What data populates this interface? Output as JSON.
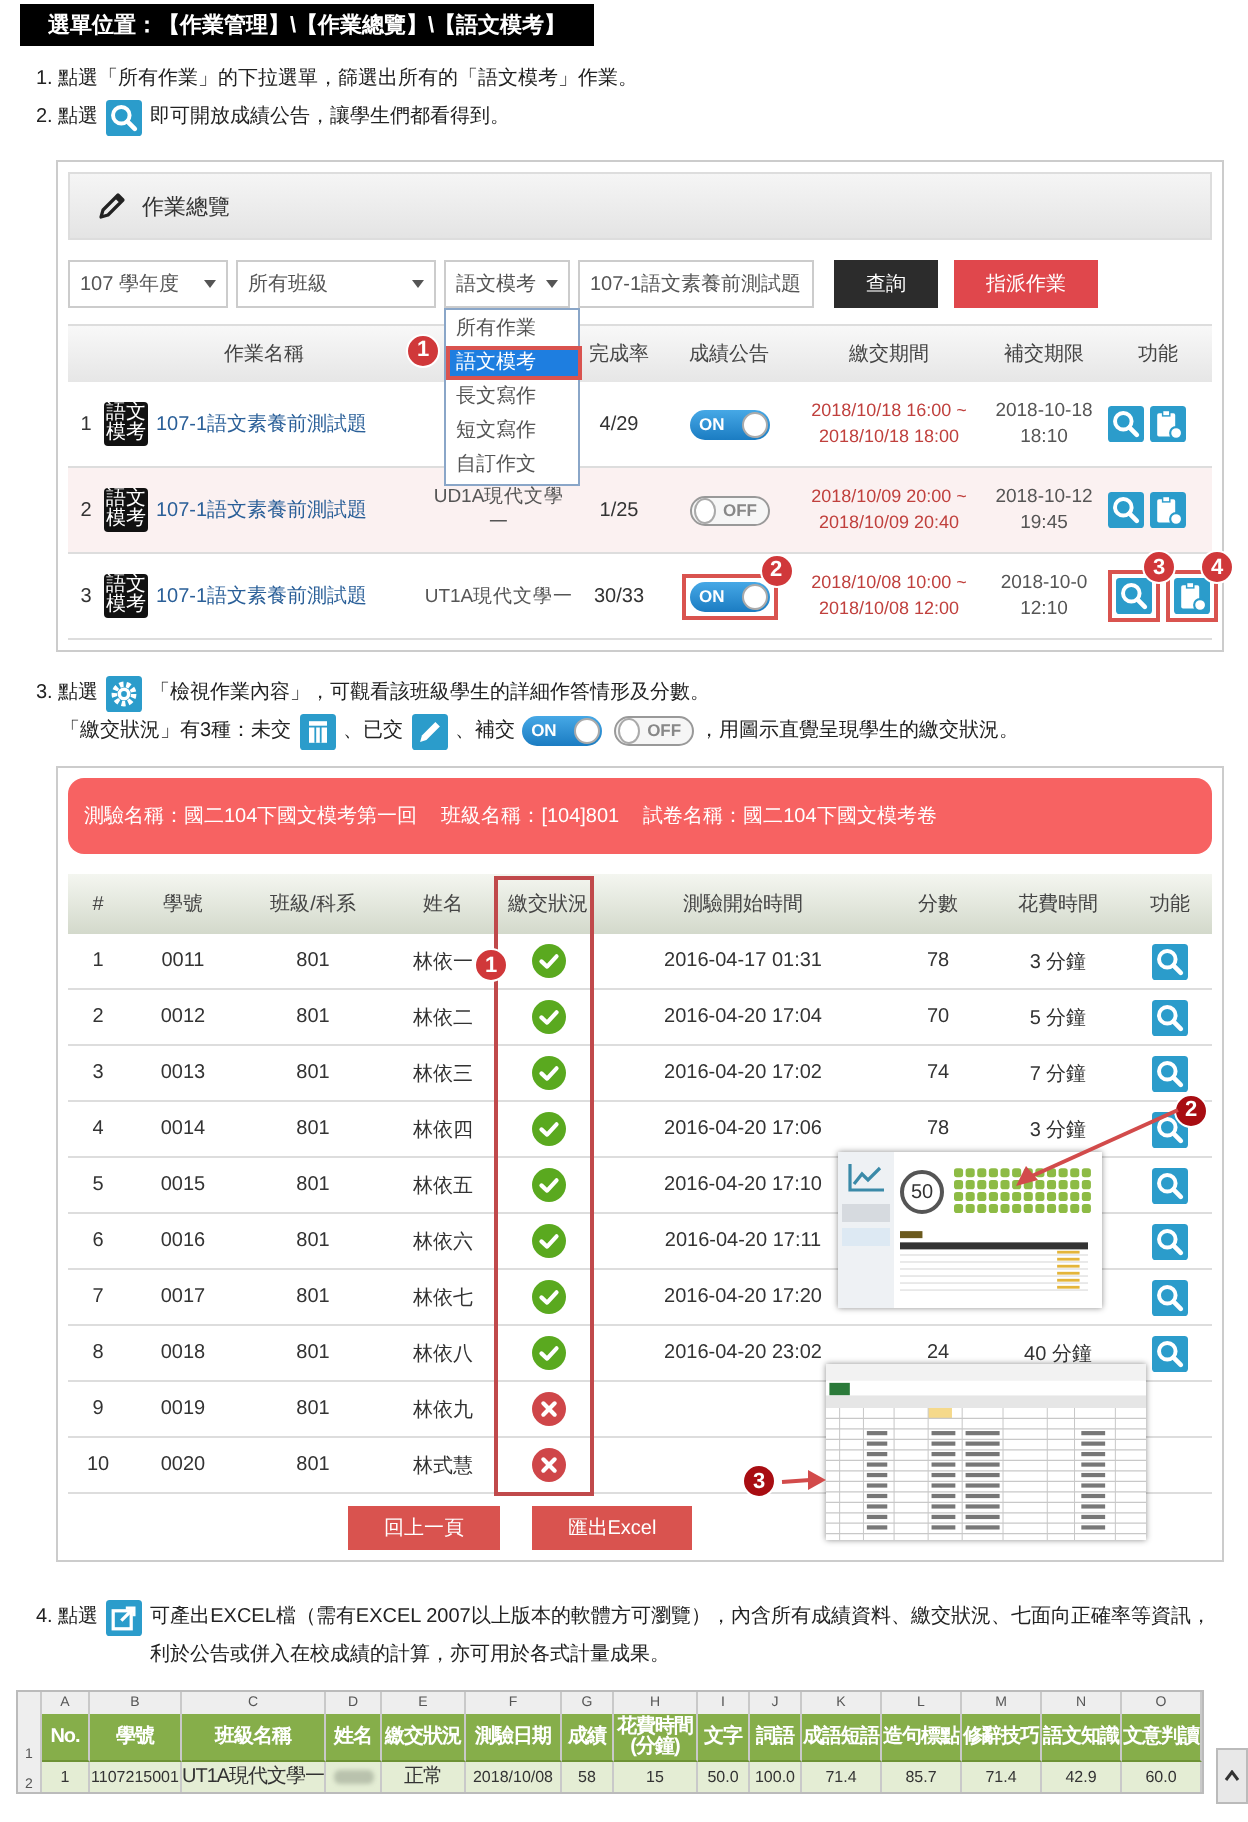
{
  "breadcrumb": "選單位置：【作業管理】\\【作業總覽】\\【語文模考】",
  "intro_steps": [
    {
      "lines": [
        [
          {
            "kind": "text",
            "text": "1. 點選「所有作業」的下拉選單，篩選出所有的「語文模考」作業。"
          }
        ]
      ]
    },
    {
      "lines": [
        [
          {
            "kind": "text",
            "text": "2. 點選"
          },
          {
            "kind": "search"
          },
          {
            "kind": "text",
            "text": "即可開放成績公告，讓學生們都看得到。"
          }
        ]
      ]
    }
  ],
  "overview": {
    "title": "作業總覽",
    "filters": [
      {
        "kind": "select",
        "value": "107 學年度"
      },
      {
        "kind": "select",
        "value": "所有班級"
      },
      {
        "kind": "select",
        "value": "語文模考",
        "options": [
          {
            "label": "所有作業",
            "selected": false
          },
          {
            "label": "語文模考",
            "selected": true,
            "callout": "1"
          },
          {
            "label": "長文寫作",
            "selected": false
          },
          {
            "label": "短文寫作",
            "selected": false
          },
          {
            "label": "自訂作文",
            "selected": false
          }
        ]
      },
      {
        "kind": "input",
        "value": "107-1語文素養前測試題"
      }
    ],
    "buttons": [
      {
        "kind": "dark",
        "label": "查詢"
      },
      {
        "kind": "danger",
        "label": "指派作業"
      }
    ],
    "columns": [
      "作業名稱",
      "完成率",
      "成績公告",
      "繳交期間",
      "補交期限",
      "功能"
    ],
    "rows": [
      {
        "index": "1",
        "badge": "語文模考",
        "name": "107-1語文素養前測試題",
        "rate": "4/29",
        "announce": {
          "on": true,
          "label": "ON"
        },
        "period": [
          "2018/10/18 16:00 ~",
          "2018/10/18 18:00"
        ],
        "deadline": [
          "2018-10-18",
          "18:10"
        ],
        "highlighted": false
      },
      {
        "index": "2",
        "badge": "語文模考",
        "name": "107-1語文素養前測試題",
        "class": "UD1A現代文學一",
        "rate": "1/25",
        "announce": {
          "on": false,
          "label": "OFF"
        },
        "period": [
          "2018/10/09 20:00 ~",
          "2018/10/09 20:40"
        ],
        "deadline": [
          "2018-10-12",
          "19:45"
        ],
        "highlighted": true
      },
      {
        "index": "3",
        "badge": "語文模考",
        "name": "107-1語文素養前測試題",
        "class": "UT1A現代文學一",
        "rate": "30/33",
        "announce": {
          "on": true,
          "label": "ON"
        },
        "period": [
          "2018/10/08 10:00 ~",
          "2018/10/08 12:00"
        ],
        "deadline": [
          "2018-10-0",
          "12:10"
        ],
        "highlighted": false,
        "callouts": {
          "announce": "2",
          "view": "3",
          "report": "4"
        }
      }
    ]
  },
  "detail_step": {
    "lines": [
      [
        {
          "kind": "text",
          "text": "3. 點選"
        },
        {
          "kind": "gear"
        },
        {
          "kind": "text",
          "text": "「檢視作業內容」，可觀看該班級學生的詳細作答情形及分數。"
        }
      ],
      [
        {
          "kind": "text",
          "text": "「繳交狀況」有3種：未交"
        },
        {
          "kind": "table"
        },
        {
          "kind": "text",
          "text": "、已交"
        },
        {
          "kind": "pencil"
        },
        {
          "kind": "text",
          "text": "、補交"
        },
        {
          "kind": "toggle",
          "on": true,
          "label": "ON"
        },
        {
          "kind": "toggle",
          "on": false,
          "label": "OFF"
        },
        {
          "kind": "text",
          "text": "，用圖示直覺呈現學生的繳交狀況。"
        }
      ]
    ]
  },
  "submissions": {
    "banner": [
      "測驗名稱：國二104下國文模考第一回",
      "班級名稱：[104]801",
      "試卷名稱：國二104下國文模考卷"
    ],
    "columns": [
      {
        "label": "#"
      },
      {
        "label": "學號"
      },
      {
        "label": "班級/科系"
      },
      {
        "label": "姓名"
      },
      {
        "label": "繳交狀況",
        "callout": "1"
      },
      {
        "label": "測驗開始時間"
      },
      {
        "label": "分數"
      },
      {
        "label": "花費時間"
      },
      {
        "label": "功能"
      }
    ],
    "rows": [
      {
        "index": "1",
        "id": "0011",
        "class": "801",
        "name": "林依一",
        "submitted": true,
        "start": "2016-04-17 01:31",
        "score": "78",
        "duration": "3 分鐘",
        "view_button": true
      },
      {
        "index": "2",
        "id": "0012",
        "class": "801",
        "name": "林依二",
        "submitted": true,
        "start": "2016-04-20 17:04",
        "score": "70",
        "duration": "5 分鐘",
        "view_button": true
      },
      {
        "index": "3",
        "id": "0013",
        "class": "801",
        "name": "林依三",
        "submitted": true,
        "start": "2016-04-20 17:02",
        "score": "74",
        "duration": "7 分鐘",
        "view_button": true
      },
      {
        "index": "4",
        "id": "0014",
        "class": "801",
        "name": "林依四",
        "submitted": true,
        "start": "2016-04-20 17:06",
        "score": "78",
        "duration": "3 分鐘",
        "view_button": true,
        "callout": "2"
      },
      {
        "index": "5",
        "id": "0015",
        "class": "801",
        "name": "林依五",
        "submitted": true,
        "start": "2016-04-20 17:10",
        "view_button": true
      },
      {
        "index": "6",
        "id": "0016",
        "class": "801",
        "name": "林依六",
        "submitted": true,
        "start": "2016-04-20 17:11",
        "view_button": true
      },
      {
        "index": "7",
        "id": "0017",
        "class": "801",
        "name": "林依七",
        "submitted": true,
        "start": "2016-04-20 17:20",
        "view_button": true
      },
      {
        "index": "8",
        "id": "0018",
        "class": "801",
        "name": "林依八",
        "submitted": true,
        "start": "2016-04-20 23:02",
        "score": "24",
        "duration": "40 分鐘",
        "view_button": true
      },
      {
        "index": "9",
        "id": "0019",
        "class": "801",
        "name": "林依九",
        "submitted": false,
        "view_button": false
      },
      {
        "index": "10",
        "id": "0020",
        "class": "801",
        "name": "林式慧",
        "submitted": false,
        "view_button": false
      }
    ],
    "buttons": [
      "回上一頁",
      "匯出Excel"
    ],
    "previews": [
      {
        "kind": "report",
        "score": "50"
      },
      {
        "kind": "spreadsheet",
        "callout": "3"
      }
    ]
  },
  "export_step": {
    "lines": [
      [
        {
          "kind": "text",
          "text": "4. 點選"
        },
        {
          "kind": "export"
        },
        {
          "kind": "text",
          "text": "可產出EXCEL檔（需有EXCEL 2007以上版本的軟體方可瀏覽），內含所有成績資料、繳交狀況、七面向正確率等資訊，利於公告或併入在校成績的計算，亦可用於各式計量成果。"
        }
      ]
    ]
  },
  "spreadsheet": {
    "column_letters": [
      "A",
      "B",
      "C",
      "D",
      "E",
      "F",
      "G",
      "H",
      "I",
      "J",
      "K",
      "L",
      "M",
      "N",
      "O"
    ],
    "row_numbers": [
      "1",
      "2"
    ],
    "headers": [
      "No.",
      "學號",
      "班級名稱",
      "姓名",
      "繳交狀況",
      "測驗日期",
      "成績",
      "花費時間(分鐘)",
      "文字",
      "詞語",
      "成語短語",
      "造句標點",
      "修辭技巧",
      "語文知識",
      "文意判讀"
    ],
    "rows": [
      [
        "1",
        "1107215001",
        "UT1A現代文學一",
        null,
        "正常",
        "2018/10/08",
        "58",
        "15",
        "50.0",
        "100.0",
        "71.4",
        "85.7",
        "71.4",
        "42.9",
        "60.0"
      ]
    ]
  }
}
